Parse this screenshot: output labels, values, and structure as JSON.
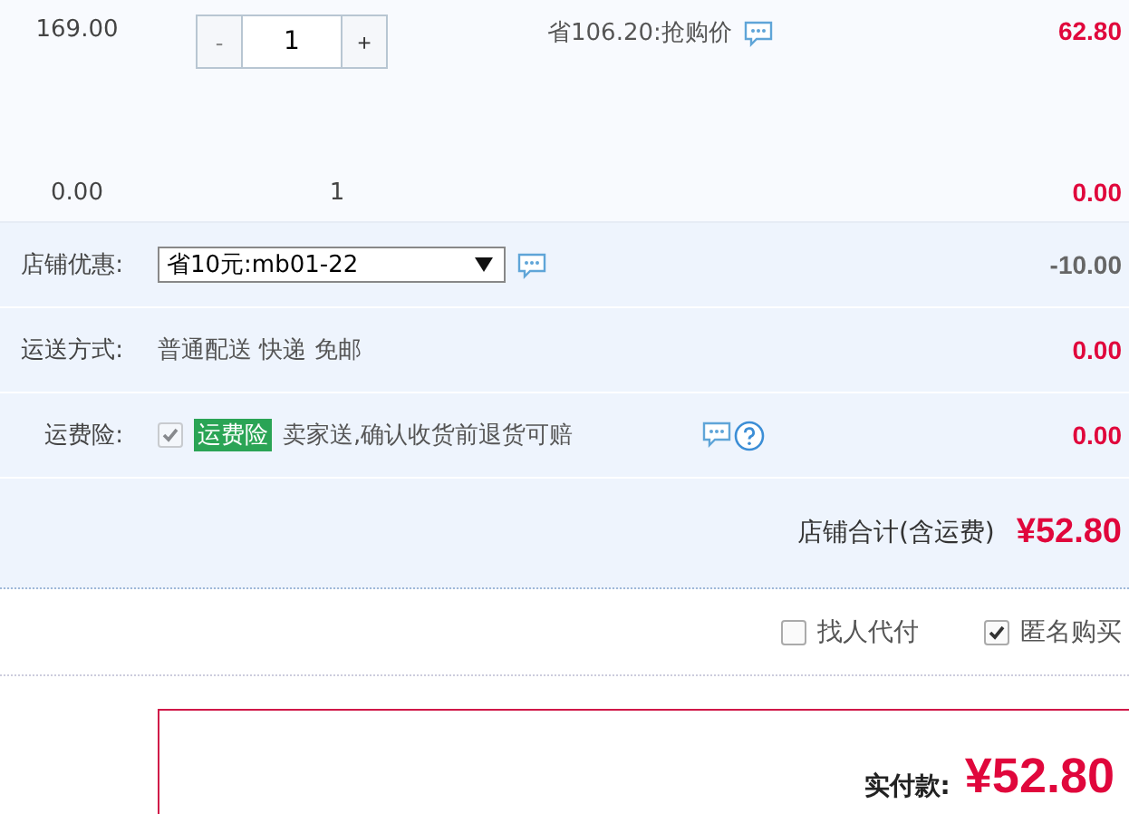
{
  "item": {
    "unit_price": "169.00",
    "decrement": "-",
    "quantity": "1",
    "increment": "+",
    "discount_note": "省106.20:抢购价",
    "subtotal": "62.80"
  },
  "extra_item": {
    "unit_price": "0.00",
    "quantity": "1",
    "subtotal": "0.00"
  },
  "options": [
    {
      "kind": "select",
      "label": "店铺优惠:",
      "value": "省10元:mb01-22",
      "amount": "-10.00"
    },
    {
      "kind": "text",
      "label": "运送方式:",
      "value": "普通配送 快递 免邮",
      "amount": "0.00"
    },
    {
      "kind": "insurance",
      "label": "运费险:",
      "checked": true,
      "disabled": true,
      "tag": "运费险",
      "value": "卖家送,确认收货前退货可赔",
      "amount": "0.00"
    }
  ],
  "store_total": {
    "label": "店铺合计(含运费)",
    "amount": "¥52.80"
  },
  "checkboxes": [
    {
      "label": "找人代付",
      "checked": false
    },
    {
      "label": "匿名购买",
      "checked": true
    }
  ],
  "payment": {
    "label": "实付款:",
    "amount": "¥52.80"
  }
}
